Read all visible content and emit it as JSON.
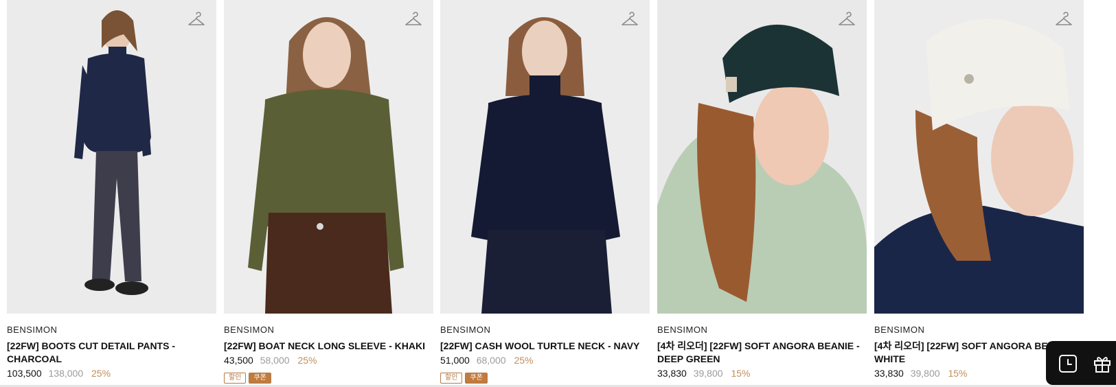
{
  "products": [
    {
      "brand": "BENSIMON",
      "name_line1": "[22FW] BOOTS CUT DETAIL PANTS -",
      "name_line2": "CHARCOAL",
      "price": "103,500",
      "original_price": "138,000",
      "discount": "25%",
      "badges": []
    },
    {
      "brand": "BENSIMON",
      "name_line1": "[22FW] BOAT NECK LONG SLEEVE - KHAKI",
      "name_line2": "",
      "price": "43,500",
      "original_price": "58,000",
      "discount": "25%",
      "badges": [
        "할인",
        "쿠폰"
      ]
    },
    {
      "brand": "BENSIMON",
      "name_line1": "[22FW] CASH WOOL TURTLE NECK - NAVY",
      "name_line2": "",
      "price": "51,000",
      "original_price": "68,000",
      "discount": "25%",
      "badges": [
        "할인",
        "쿠폰"
      ]
    },
    {
      "brand": "BENSIMON",
      "name_line1": "[4차 리오더] [22FW] SOFT ANGORA BEANIE -",
      "name_line2": "DEEP GREEN",
      "price": "33,830",
      "original_price": "39,800",
      "discount": "15%",
      "badges": []
    },
    {
      "brand": "BENSIMON",
      "name_line1": "[4차 리오더] [22FW] SOFT ANGORA BEANIE -",
      "name_line2": "WHITE",
      "price": "33,830",
      "original_price": "39,800",
      "discount": "15%",
      "badges": []
    }
  ],
  "icons": {
    "wishlist": "hanger-icon",
    "recent": "clock-icon",
    "gift": "gift-icon"
  },
  "colors": {
    "discount": "#c28d5a",
    "original_price": "#9b9b9b",
    "coupon_badge": "#c07b3f",
    "floating_bar": "#111111"
  }
}
